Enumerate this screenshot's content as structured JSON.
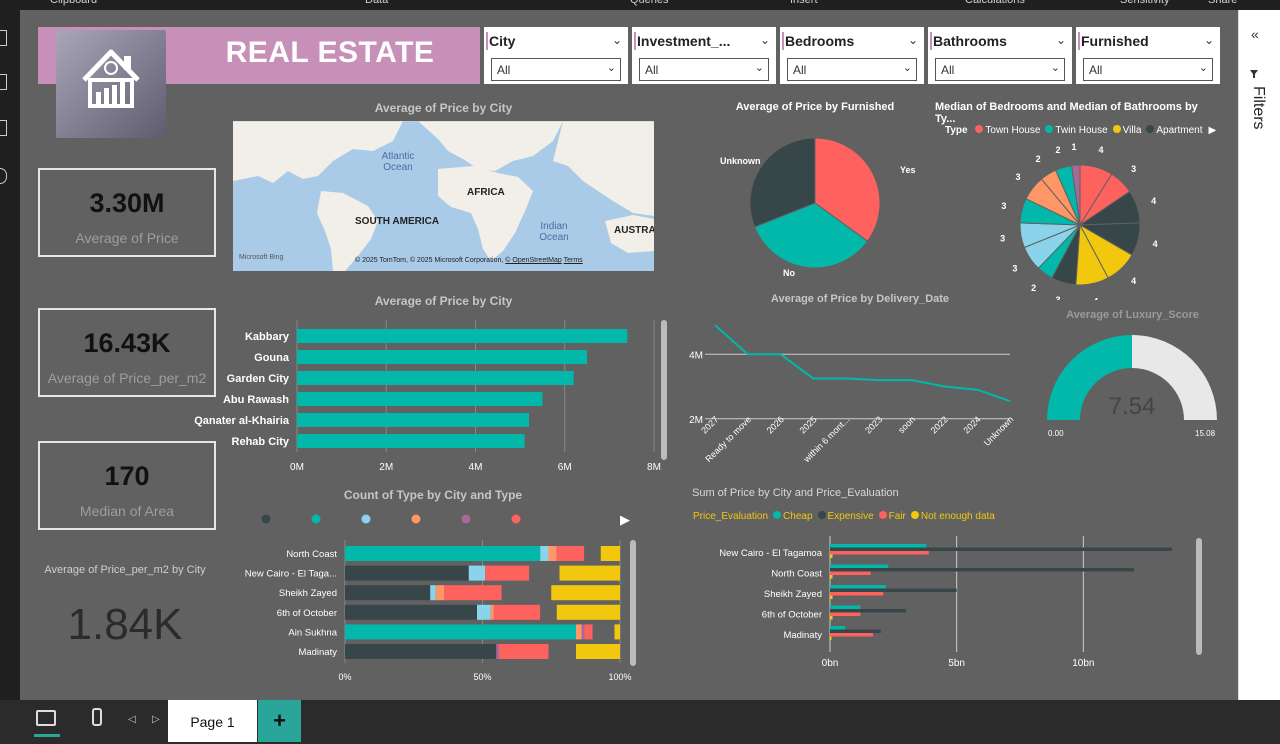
{
  "ribbon": [
    "Clipboard",
    "Data",
    "Queries",
    "Insert",
    "Calculations",
    "Sensitivity",
    "Share"
  ],
  "banner": {
    "title": "REAL ESTATE"
  },
  "slicers": [
    {
      "label": "City",
      "value": "All"
    },
    {
      "label": "Investment_...",
      "value": "All"
    },
    {
      "label": "Bedrooms",
      "value": "All"
    },
    {
      "label": "Bathrooms",
      "value": "All"
    },
    {
      "label": "Furnished",
      "value": "All"
    }
  ],
  "cards": [
    {
      "value": "3.30M",
      "label": "Average of Price"
    },
    {
      "value": "16.43K",
      "label": "Average of Price_per_m2"
    },
    {
      "value": "170",
      "label": "Median of Area"
    }
  ],
  "ppm_card": {
    "title": "Average of Price_per_m2 by City",
    "value": "1.84K"
  },
  "map": {
    "title": "Average of Price by City",
    "labels": [
      "Atlantic Ocean",
      "AFRICA",
      "SOUTH AMERICA",
      "Indian Ocean",
      "AUSTRA"
    ],
    "bing": "Microsoft Bing",
    "credits": "© 2025 TomTom, © 2025 Microsoft Corporation,",
    "osm": "© OpenStreetMap",
    "terms": "Terms"
  },
  "pie_furnished": {
    "title": "Average of Price by Furnished",
    "chart_data": {
      "type": "pie",
      "labels": [
        "Yes",
        "No",
        "Unknown"
      ],
      "values": [
        35,
        34,
        31
      ],
      "colors": [
        "#fd625e",
        "#01b8aa",
        "#374649"
      ]
    }
  },
  "pie_median": {
    "title": "Median of Bedrooms and Median of Bathrooms by Ty...",
    "legend_title": "Type",
    "legend": [
      {
        "name": "Town House",
        "color": "#fd625e"
      },
      {
        "name": "Twin House",
        "color": "#01b8aa"
      },
      {
        "name": "Villa",
        "color": "#f2c80f"
      },
      {
        "name": "Apartment",
        "color": "#374649"
      }
    ],
    "chart_data": {
      "type": "pie",
      "values": [
        4,
        3,
        4,
        4,
        4,
        4,
        3,
        2,
        3,
        3,
        3,
        3,
        2,
        2,
        1
      ],
      "colors": [
        "#fd625e",
        "#fd625e",
        "#374649",
        "#374649",
        "#f2c80f",
        "#f2c80f",
        "#374649",
        "#01b8aa",
        "#8ad4eb",
        "#8ad4eb",
        "#01b8aa",
        "#fe9666",
        "#fe9666",
        "#01b8aa",
        "#a66999"
      ]
    }
  },
  "bar_city": {
    "title": "Average of Price by City",
    "chart_data": {
      "type": "bar",
      "categories": [
        "Kabbary",
        "Gouna",
        "Garden City",
        "Abu Rawash",
        "Qanater al-Khairia",
        "Rehab City"
      ],
      "values": [
        7.4,
        6.5,
        6.2,
        5.5,
        5.2,
        5.1
      ],
      "xticks": [
        "0M",
        "2M",
        "4M",
        "6M",
        "8M"
      ],
      "xlim": [
        0,
        8
      ],
      "unit": "M",
      "color": "#01b8aa"
    }
  },
  "line_delivery": {
    "title": "Average of Price by Delivery_Date",
    "chart_data": {
      "type": "line",
      "categories": [
        "2027",
        "Ready to move",
        "2026",
        "2025",
        "within 6 mont...",
        "2023",
        "soon",
        "2022",
        "2024",
        "Unknown"
      ],
      "values": [
        4.9,
        4.0,
        4.0,
        3.25,
        3.25,
        3.2,
        3.2,
        3.0,
        2.9,
        2.55
      ],
      "yticks": [
        "4M",
        "2M"
      ],
      "ytick_values": [
        4,
        2
      ],
      "ylim": [
        1.9,
        5
      ],
      "color": "#01b8aa"
    }
  },
  "gauge": {
    "title": "Average of Luxury_Score",
    "value": "7.54",
    "min": "0.00",
    "max": "15.08",
    "chart_data": {
      "type": "gauge",
      "value": 7.54,
      "min": 0,
      "max": 15.08
    }
  },
  "stacked": {
    "title": "Count of Type by City and Type",
    "legend_colors": [
      "#374649",
      "#01b8aa",
      "#8ad4eb",
      "#fe9666",
      "#a66999",
      "#fd625e"
    ],
    "chart_data": {
      "type": "bar",
      "categories": [
        "North Coast",
        "New Cairo - El Taga...",
        "Sheikh Zayed",
        "6th of October",
        "Ain Sukhna",
        "Madinaty"
      ],
      "series": [
        {
          "color": "#01b8aa",
          "values": [
            71,
            0,
            0,
            0,
            84,
            0
          ]
        },
        {
          "color": "#374649",
          "values": [
            0,
            45,
            31,
            48,
            0,
            55
          ]
        },
        {
          "color": "#8ad4eb",
          "values": [
            3,
            6,
            2,
            5,
            0,
            0
          ]
        },
        {
          "color": "#fe9666",
          "values": [
            3,
            0,
            3,
            1,
            2,
            0
          ]
        },
        {
          "color": "#a66999",
          "values": [
            0,
            0,
            0,
            0,
            1,
            1
          ]
        },
        {
          "color": "#fd625e",
          "values": [
            10,
            16,
            21,
            17,
            3,
            18
          ]
        },
        {
          "color": "#616161",
          "values": [
            6,
            11,
            18,
            6,
            8,
            10
          ]
        },
        {
          "color": "#f2c80f",
          "values": [
            7,
            22,
            25,
            23,
            2,
            16
          ]
        }
      ],
      "xticks": [
        "0%",
        "50%",
        "100%"
      ]
    }
  },
  "clustered": {
    "title": "Sum of Price by City and Price_Evaluation",
    "legend_title": "Price_Evaluation",
    "legend": [
      {
        "name": "Cheap",
        "color": "#01b8aa"
      },
      {
        "name": "Expensive",
        "color": "#374649"
      },
      {
        "name": "Fair",
        "color": "#fd625e"
      },
      {
        "name": "Not enough data",
        "color": "#f2c80f"
      }
    ],
    "chart_data": {
      "type": "bar",
      "categories": [
        "New Cairo - El Tagamoa",
        "North Coast",
        "Sheikh Zayed",
        "6th of October",
        "Madinaty"
      ],
      "series": [
        {
          "name": "Cheap",
          "color": "#01b8aa",
          "values": [
            3.8,
            2.3,
            2.2,
            1.2,
            0.6
          ]
        },
        {
          "name": "Expensive",
          "color": "#374649",
          "values": [
            13.5,
            12.0,
            5.0,
            3.0,
            2.0
          ]
        },
        {
          "name": "Fair",
          "color": "#fd625e",
          "values": [
            3.9,
            1.6,
            2.1,
            1.2,
            1.7
          ]
        },
        {
          "name": "Not enough data",
          "color": "#f2c80f",
          "values": [
            0.1,
            0.1,
            0.1,
            0.1,
            0.05
          ]
        }
      ],
      "xticks": [
        "0bn",
        "5bn",
        "10bn"
      ],
      "xlim": [
        0,
        15
      ]
    }
  },
  "filters_pane": {
    "label": "Filters",
    "collapse": "«"
  },
  "pages": {
    "active": "Page 1",
    "add": "+"
  }
}
